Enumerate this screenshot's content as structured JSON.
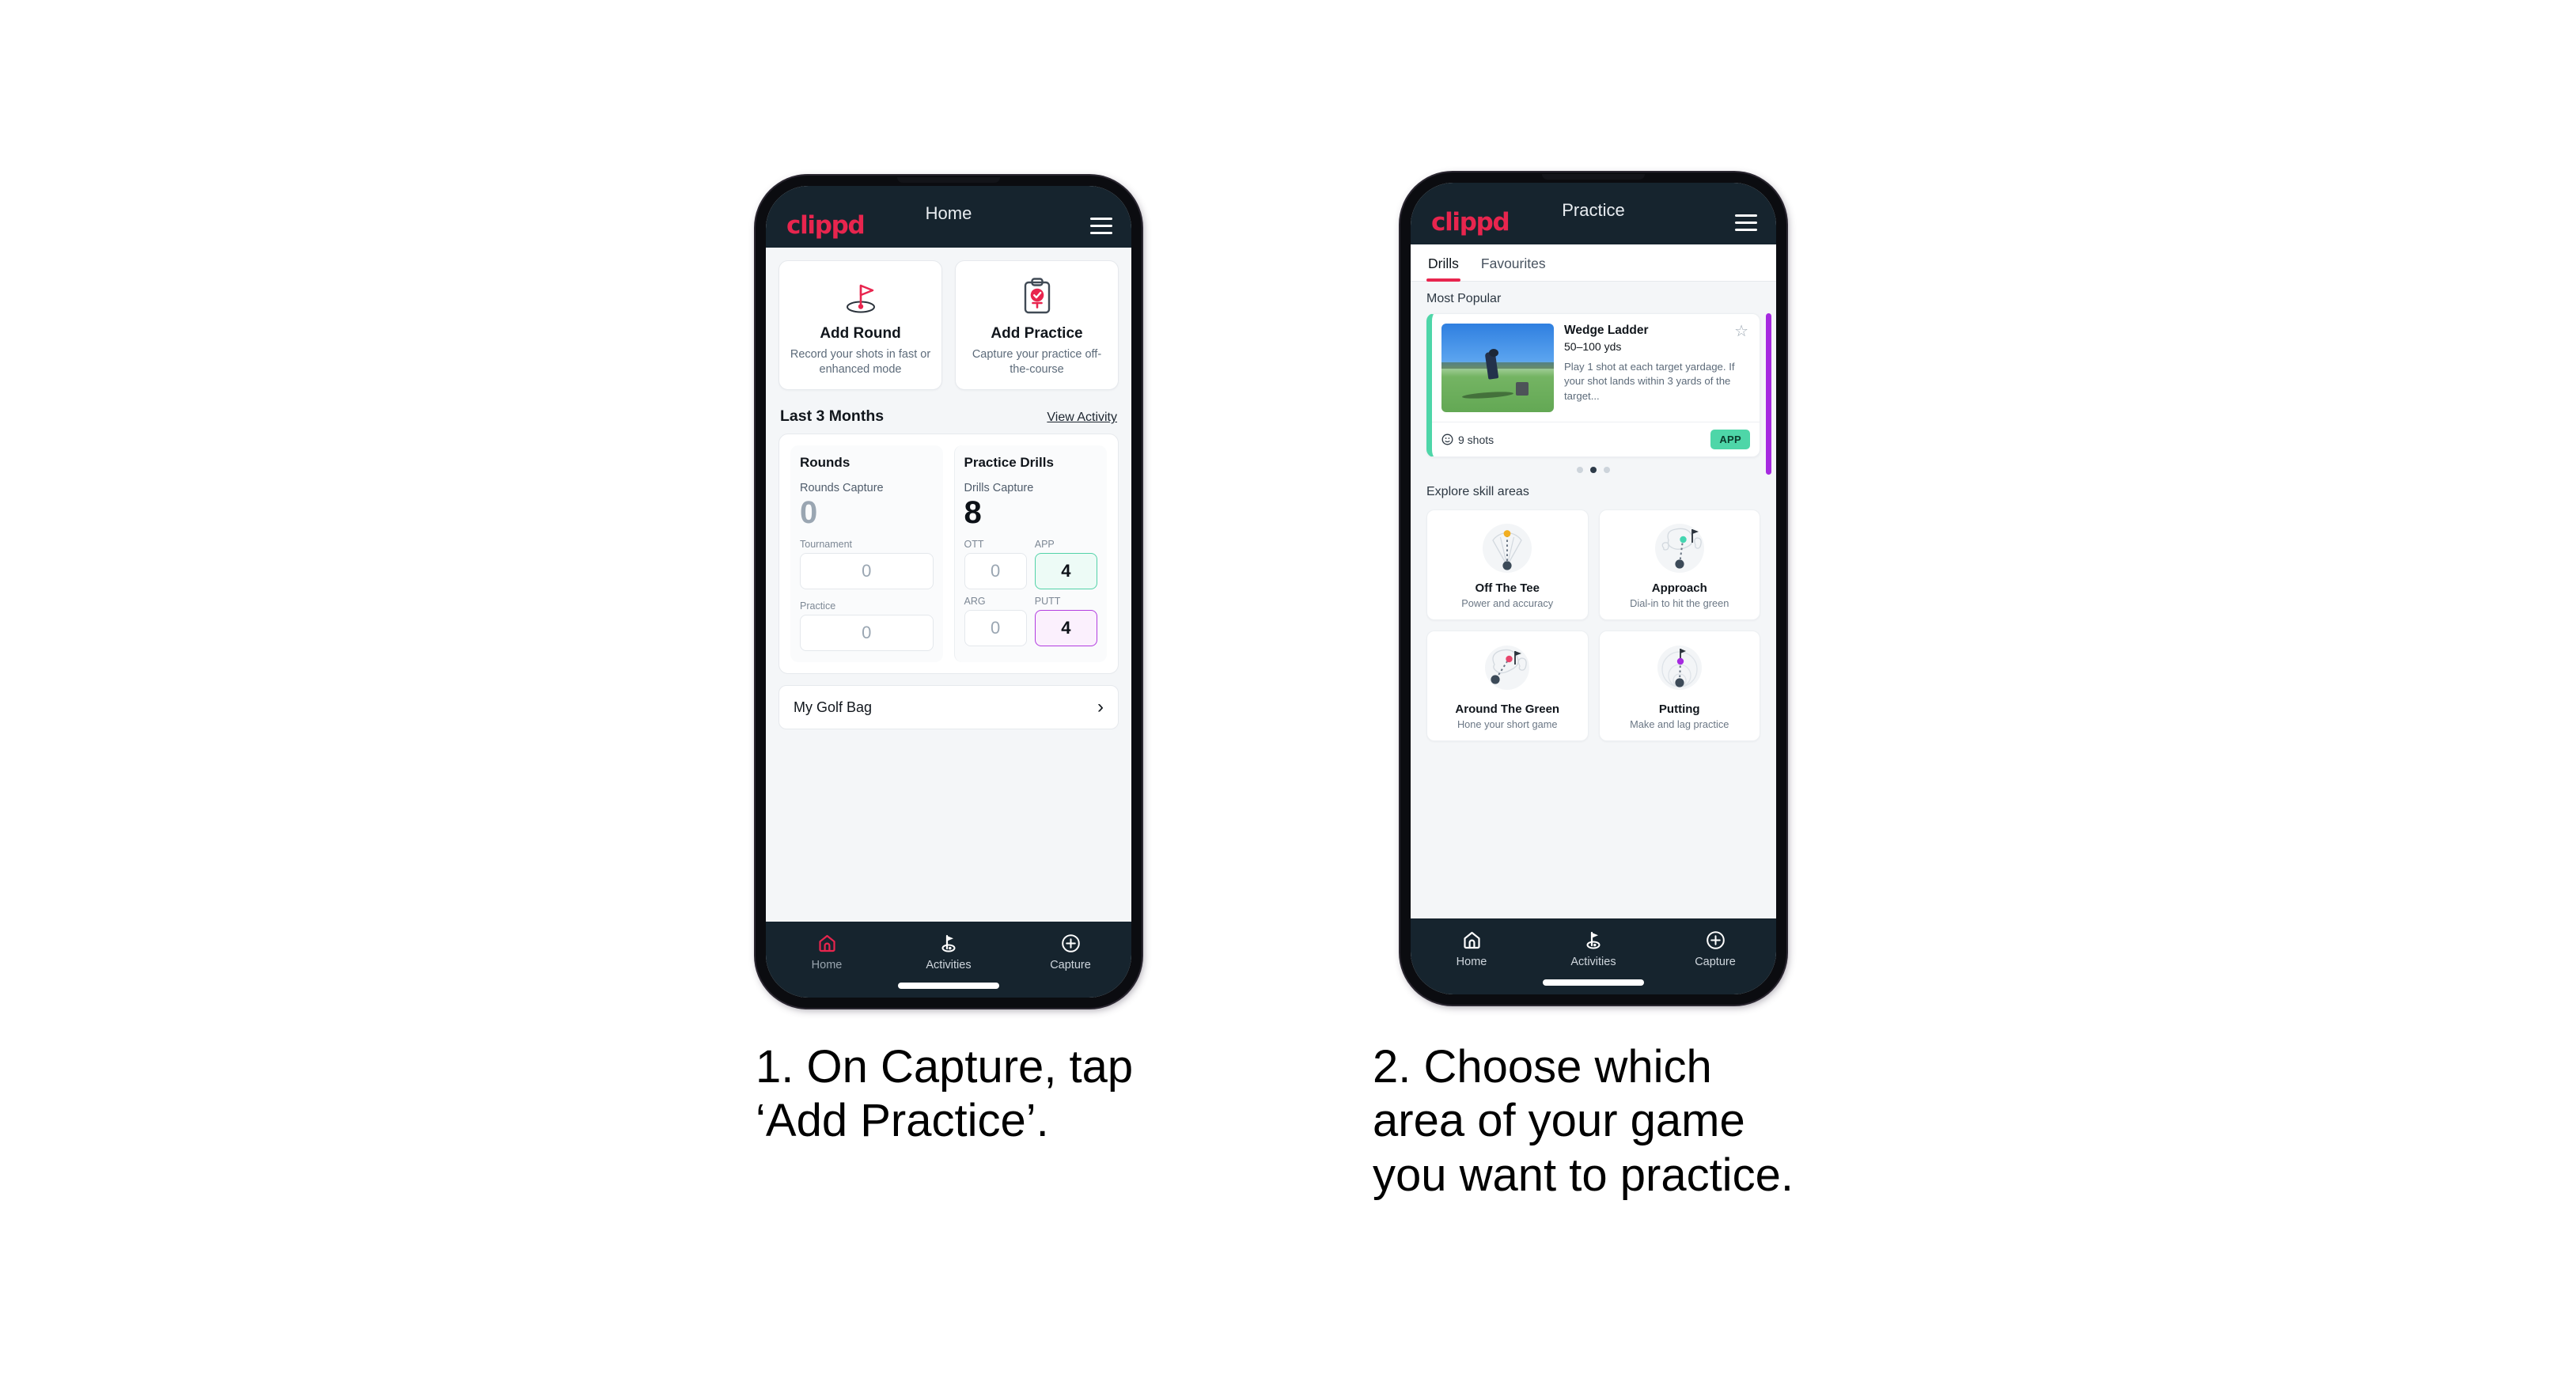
{
  "colors": {
    "brand_pink": "#e8254e",
    "appbar_dark": "#16242e",
    "accent_green": "#4ed6a8",
    "accent_purple": "#a62ae0",
    "page_bg": "#f4f6f8"
  },
  "phone1": {
    "appbar": {
      "logo": "clippd",
      "title": "Home",
      "menu_icon": "hamburger-menu-icon"
    },
    "actions": [
      {
        "icon": "golf-flag-hole-icon",
        "title": "Add Round",
        "subtitle": "Record your shots in fast or enhanced mode"
      },
      {
        "icon": "clipboard-golf-ball-check-icon",
        "title": "Add Practice",
        "subtitle": "Capture your practice off-the-course"
      }
    ],
    "section": {
      "title": "Last 3 Months",
      "link": "View Activity"
    },
    "stats": {
      "rounds": {
        "heading": "Rounds",
        "capture_label": "Rounds Capture",
        "capture_value": "0",
        "items": [
          {
            "label": "Tournament",
            "value": "0",
            "state": "empty"
          },
          {
            "label": "Practice",
            "value": "0",
            "state": "empty"
          }
        ]
      },
      "drills": {
        "heading": "Practice Drills",
        "capture_label": "Drills Capture",
        "capture_value": "8",
        "items": [
          {
            "label": "OTT",
            "value": "0",
            "state": "empty"
          },
          {
            "label": "APP",
            "value": "4",
            "state": "app"
          },
          {
            "label": "ARG",
            "value": "0",
            "state": "empty"
          },
          {
            "label": "PUTT",
            "value": "4",
            "state": "putt"
          }
        ]
      }
    },
    "golf_bag": {
      "label": "My Golf Bag",
      "chevron": "chevron-right-icon"
    },
    "nav": [
      {
        "icon": "home-icon",
        "label": "Home",
        "active": true
      },
      {
        "icon": "golf-flag-activities-icon",
        "label": "Activities",
        "active": false
      },
      {
        "icon": "plus-circle-capture-icon",
        "label": "Capture",
        "active": false
      }
    ]
  },
  "phone2": {
    "appbar": {
      "logo": "clippd",
      "title": "Practice",
      "menu_icon": "hamburger-menu-icon"
    },
    "tabs": [
      {
        "label": "Drills",
        "active": true
      },
      {
        "label": "Favourites",
        "active": false
      }
    ],
    "most_popular_label": "Most Popular",
    "drill": {
      "name": "Wedge Ladder",
      "yardage": "50–100 yds",
      "description": "Play 1 shot at each target yardage. If your shot lands within 3 yards of the target...",
      "shots": "9 shots",
      "shots_icon": "clock-icon",
      "badge": "APP",
      "favourite_icon": "star-outline-icon"
    },
    "carousel_dots": {
      "count": 3,
      "active_index": 1
    },
    "explore_label": "Explore skill areas",
    "skill_areas": [
      {
        "icon": "off-the-tee-fan-icon",
        "title": "Off The Tee",
        "subtitle": "Power and accuracy"
      },
      {
        "icon": "approach-green-icon",
        "title": "Approach",
        "subtitle": "Dial-in to hit the green"
      },
      {
        "icon": "around-the-green-icon",
        "title": "Around The Green",
        "subtitle": "Hone your short game"
      },
      {
        "icon": "putting-rings-icon",
        "title": "Putting",
        "subtitle": "Make and lag practice"
      }
    ],
    "nav": [
      {
        "icon": "home-icon",
        "label": "Home",
        "active": false
      },
      {
        "icon": "golf-flag-activities-icon",
        "label": "Activities",
        "active": false
      },
      {
        "icon": "plus-circle-capture-icon",
        "label": "Capture",
        "active": false
      }
    ]
  },
  "captions": {
    "step1": "1. On Capture, tap\n‘Add Practice’.",
    "step2": "2. Choose which\narea of your game\nyou want to practice."
  }
}
